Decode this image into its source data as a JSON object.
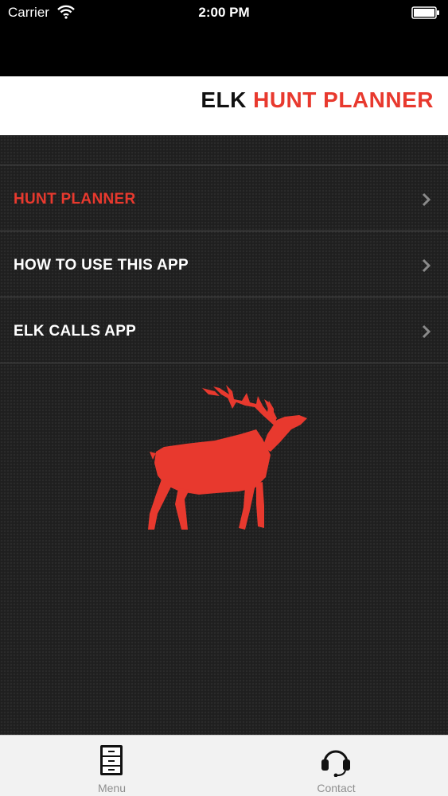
{
  "status": {
    "carrier": "Carrier",
    "time": "2:00 PM"
  },
  "header": {
    "title_part1": "ELK",
    "title_part2": "HUNT PLANNER"
  },
  "menu": {
    "items": [
      {
        "label": "HUNT PLANNER",
        "active": true
      },
      {
        "label": "HOW TO USE THIS APP",
        "active": false
      },
      {
        "label": "ELK CALLS APP",
        "active": false
      }
    ]
  },
  "tabs": [
    {
      "label": "Menu",
      "icon": "file-cabinet-icon"
    },
    {
      "label": "Contact",
      "icon": "headset-icon"
    }
  ],
  "colors": {
    "accent": "#e8392e",
    "header_bg": "#ffffff",
    "content_bg": "#1f1f1f",
    "tabbar_bg": "#f2f2f2"
  }
}
